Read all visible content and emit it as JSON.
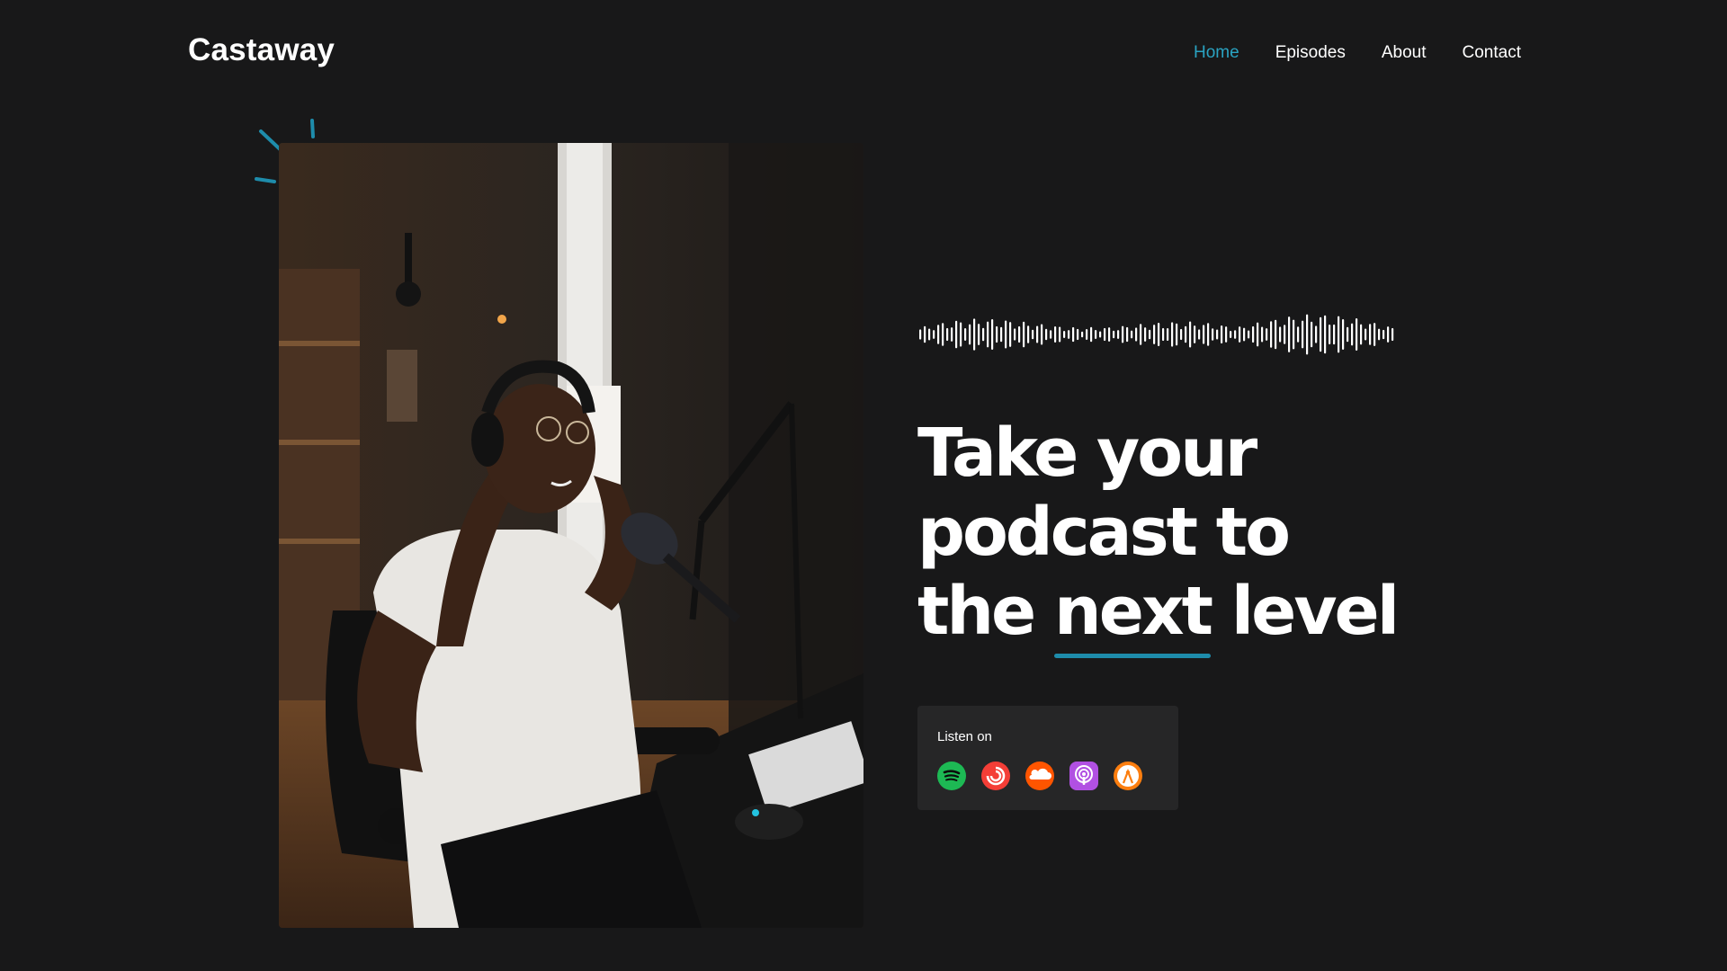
{
  "brand": {
    "name": "Castaway"
  },
  "nav": {
    "items": [
      {
        "label": "Home",
        "active": true
      },
      {
        "label": "Episodes",
        "active": false
      },
      {
        "label": "About",
        "active": false
      },
      {
        "label": "Contact",
        "active": false
      }
    ]
  },
  "hero": {
    "headline": {
      "line1": "Take your",
      "line2": "podcast to",
      "line3_pre": "the",
      "line3_highlight": "next",
      "line3_post": "level"
    },
    "image_alt": "Podcaster wearing headphones speaking into a microphone",
    "listen": {
      "label": "Listen on",
      "platforms": [
        {
          "name": "Spotify",
          "icon": "spotify-icon",
          "color": "#1db954"
        },
        {
          "name": "Pocket Casts",
          "icon": "pocket-casts-icon",
          "color": "#f43e37"
        },
        {
          "name": "SoundCloud",
          "icon": "soundcloud-icon",
          "color": "#ff5500"
        },
        {
          "name": "Apple Podcasts",
          "icon": "apple-podcasts-icon",
          "color": "#b150e2"
        },
        {
          "name": "Overcast",
          "icon": "overcast-icon",
          "color": "#fc7e0f"
        }
      ]
    }
  },
  "colors": {
    "background": "#181819",
    "accent": "#2aa3c2",
    "card": "#262627"
  }
}
